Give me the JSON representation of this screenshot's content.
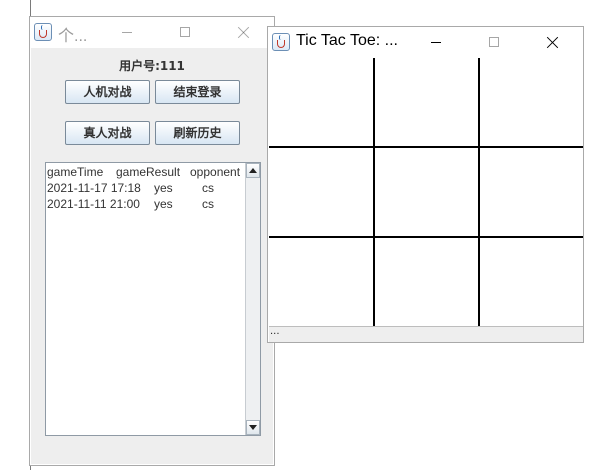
{
  "user_window": {
    "title": "个...",
    "user_label": "用户号:111",
    "buttons": {
      "vs_computer": "人机对战",
      "logout": "结束登录",
      "vs_human": "真人对战",
      "refresh_history": "刷新历史"
    },
    "history": {
      "headers": [
        "gameTime",
        "gameResult",
        "opponent"
      ],
      "rows": [
        [
          "2021-11-17 17:18",
          "yes",
          "cs"
        ],
        [
          "2021-11-11 21:00",
          "yes",
          "cs"
        ]
      ]
    }
  },
  "game_window": {
    "title": "Tic Tac Toe: ...",
    "status": "...",
    "board": [
      [
        "",
        "",
        ""
      ],
      [
        "",
        "",
        ""
      ],
      [
        "",
        "",
        ""
      ]
    ]
  }
}
